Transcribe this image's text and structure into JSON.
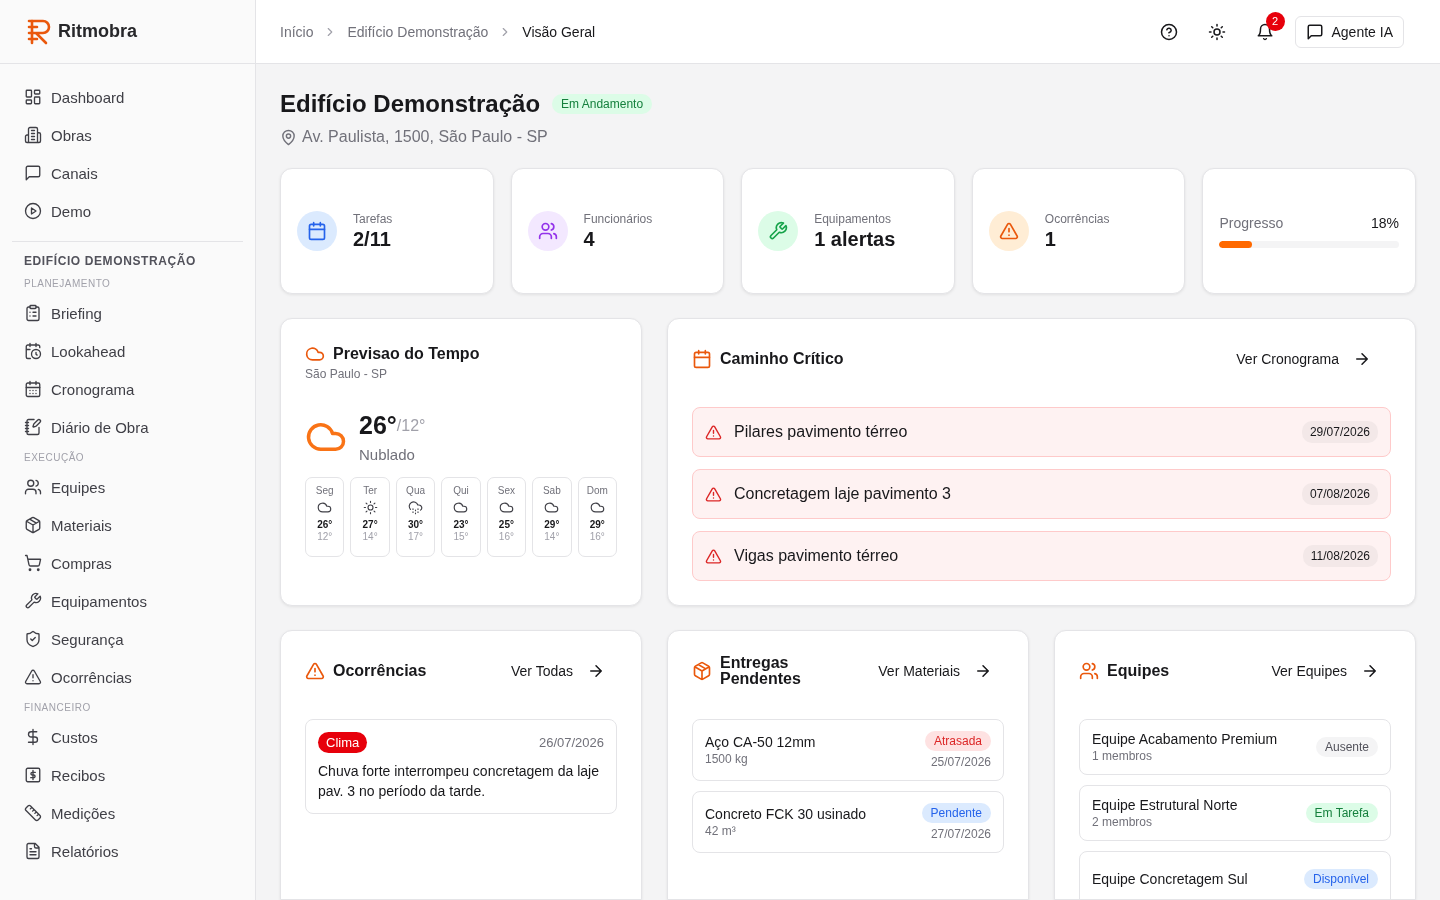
{
  "brand": {
    "name": "Ritmobra"
  },
  "sidebar": {
    "main": [
      {
        "label": "Dashboard"
      },
      {
        "label": "Obras"
      },
      {
        "label": "Canais"
      },
      {
        "label": "Demo"
      }
    ],
    "project": "EDIFÍCIO DEMONSTRAÇÃO",
    "groups": [
      {
        "label": "PLANEJAMENTO",
        "items": [
          {
            "label": "Briefing"
          },
          {
            "label": "Lookahead"
          },
          {
            "label": "Cronograma"
          },
          {
            "label": "Diário de Obra"
          }
        ]
      },
      {
        "label": "EXECUÇÃO",
        "items": [
          {
            "label": "Equipes"
          },
          {
            "label": "Materiais"
          },
          {
            "label": "Compras"
          },
          {
            "label": "Equipamentos"
          },
          {
            "label": "Segurança"
          },
          {
            "label": "Ocorrências"
          }
        ]
      },
      {
        "label": "FINANCEIRO",
        "items": [
          {
            "label": "Custos"
          },
          {
            "label": "Recibos"
          },
          {
            "label": "Medições"
          },
          {
            "label": "Relatórios"
          }
        ]
      }
    ]
  },
  "breadcrumb": [
    {
      "label": "Início",
      "current": false
    },
    {
      "label": "Edifício Demonstração",
      "current": false
    },
    {
      "label": "Visão Geral",
      "current": true
    }
  ],
  "header": {
    "notifications": "2",
    "agent_button": "Agente IA"
  },
  "project": {
    "title": "Edifício Demonstração",
    "status": {
      "label": "Em Andamento",
      "kind": "success"
    },
    "address": "Av. Paulista, 1500, São Paulo - SP"
  },
  "stats": [
    {
      "kind": "tasks",
      "label": "Tarefas",
      "value": "2/11"
    },
    {
      "kind": "people",
      "label": "Funcionários",
      "value": "4"
    },
    {
      "kind": "equipment",
      "label": "Equipamentos",
      "value": "1 alertas"
    },
    {
      "kind": "incident",
      "label": "Ocorrências",
      "value": "1"
    },
    {
      "kind": "progress",
      "label": "Progresso",
      "value": "18%",
      "level": 0.18
    }
  ],
  "weather": {
    "title": "Previsao do Tempo",
    "location": "São Paulo - SP",
    "current": {
      "kind": "cloud",
      "temp": "26°",
      "low": "/12°",
      "condition": "Nublado"
    },
    "days": [
      {
        "day": "Seg",
        "kind": "cloud",
        "high": "26°",
        "low": "12°"
      },
      {
        "day": "Ter",
        "kind": "sun",
        "high": "27°",
        "low": "14°"
      },
      {
        "day": "Qua",
        "kind": "rain",
        "high": "30°",
        "low": "17°"
      },
      {
        "day": "Qui",
        "kind": "cloud",
        "high": "23°",
        "low": "15°"
      },
      {
        "day": "Sex",
        "kind": "cloud",
        "high": "25°",
        "low": "16°"
      },
      {
        "day": "Sab",
        "kind": "cloud",
        "high": "29°",
        "low": "14°"
      },
      {
        "day": "Dom",
        "kind": "cloud",
        "high": "29°",
        "low": "16°"
      }
    ]
  },
  "critical_path": {
    "title": "Caminho Crítico",
    "link": "Ver Cronograma",
    "items": [
      {
        "name": "Pilares pavimento térreo",
        "date": "29/07/2026"
      },
      {
        "name": "Concretagem laje pavimento 3",
        "date": "07/08/2026"
      },
      {
        "name": "Vigas pavimento térreo",
        "date": "11/08/2026"
      }
    ]
  },
  "occurrences": {
    "title": "Ocorrências",
    "link": "Ver Todas",
    "items": [
      {
        "tag": "Clima",
        "date": "26/07/2026",
        "text": "Chuva forte interrompeu concretagem da laje pav. 3 no período da tarde."
      }
    ]
  },
  "deliveries": {
    "title": "Entregas Pendentes",
    "link": "Ver Materiais",
    "items": [
      {
        "name": "Aço CA-50 12mm",
        "qty": "1500 kg",
        "status": {
          "label": "Atrasada",
          "kind": "danger"
        },
        "date": "25/07/2026"
      },
      {
        "name": "Concreto FCK 30 usinado",
        "qty": "42 m³",
        "status": {
          "label": "Pendente",
          "kind": "info"
        },
        "date": "27/07/2026"
      }
    ]
  },
  "teams": {
    "title": "Equipes",
    "link": "Ver Equipes",
    "items": [
      {
        "name": "Equipe Acabamento Premium",
        "members": "1 membros",
        "status": {
          "label": "Ausente",
          "kind": "neutral"
        }
      },
      {
        "name": "Equipe Estrutural Norte",
        "members": "2 membros",
        "status": {
          "label": "Em Tarefa",
          "kind": "success"
        }
      },
      {
        "name": "Equipe Concretagem Sul",
        "status": {
          "label": "Disponível",
          "kind": "info"
        }
      }
    ]
  }
}
